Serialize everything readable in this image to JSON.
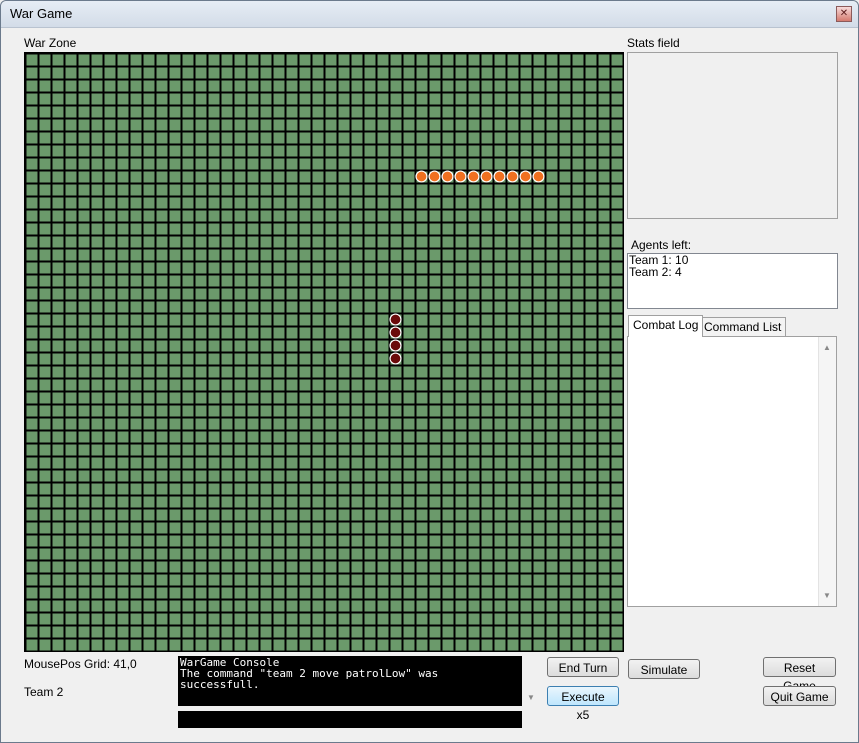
{
  "window": {
    "title": "War Game",
    "close_glyph": "✕"
  },
  "war_zone": {
    "label": "War Zone",
    "cols": 46,
    "rows": 46,
    "grid_color": "#6b9a6b",
    "line_color": "#000000",
    "team1_color": "#f07020",
    "team2_color": "#6a0a0a",
    "team1_agents": [
      [
        30,
        9
      ],
      [
        31,
        9
      ],
      [
        32,
        9
      ],
      [
        33,
        9
      ],
      [
        34,
        9
      ],
      [
        35,
        9
      ],
      [
        36,
        9
      ],
      [
        37,
        9
      ],
      [
        38,
        9
      ],
      [
        39,
        9
      ]
    ],
    "team2_agents": [
      [
        28,
        20
      ],
      [
        28,
        21
      ],
      [
        28,
        22
      ],
      [
        28,
        23
      ]
    ]
  },
  "stats": {
    "label": "Stats field"
  },
  "agents_left": {
    "label": "Agents left:",
    "lines": [
      "Team 1: 10",
      "Team 2: 4"
    ]
  },
  "tabs": [
    {
      "label": "Combat Log",
      "active": true
    },
    {
      "label": "Command List",
      "active": false
    }
  ],
  "status": {
    "mouse_pos": "MousePos Grid: 41,0",
    "team": "Team 2"
  },
  "console": {
    "lines": [
      "WarGame Console",
      "The command \"team 2 move patrolLow\" was",
      "successfull."
    ],
    "input_value": ""
  },
  "buttons": {
    "end_turn": "End Turn",
    "execute_x5": "Execute x5",
    "simulate": "Simulate",
    "reset_game": "Reset Game",
    "quit_game": "Quit Game"
  }
}
